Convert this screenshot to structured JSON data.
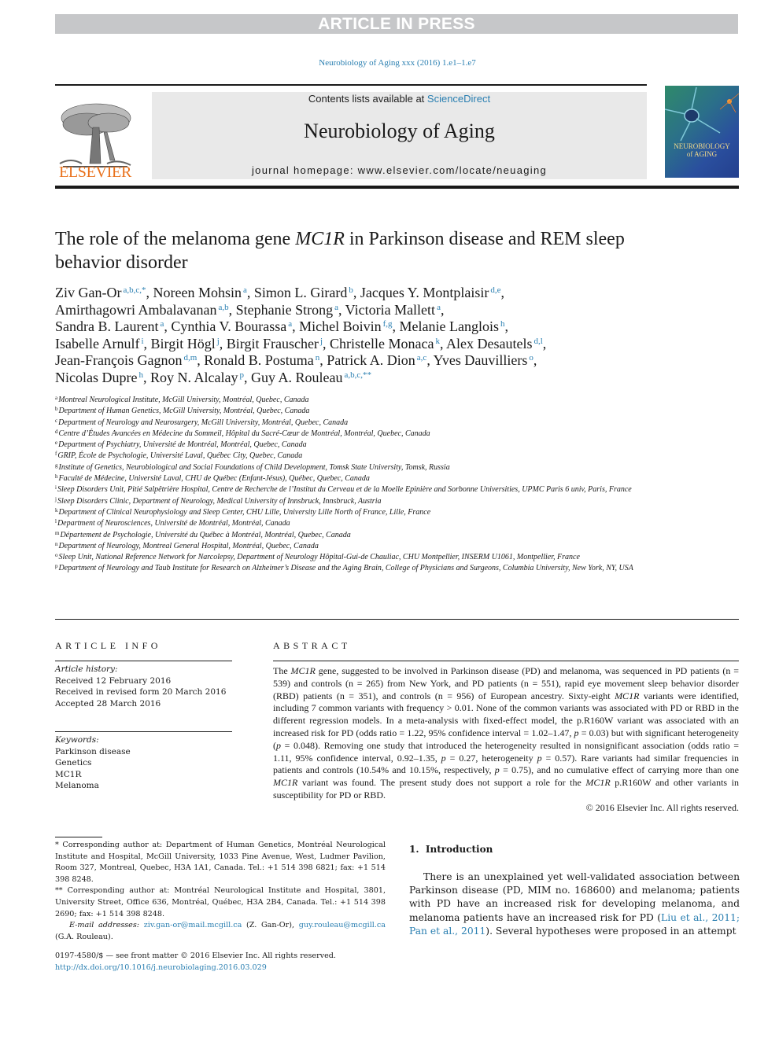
{
  "banner": {
    "text": "ARTICLE IN PRESS"
  },
  "citation": "Neurobiology of Aging xxx (2016) 1.e1–1.e7",
  "masthead": {
    "contents_prefix": "Contents lists available at ",
    "contents_link": "ScienceDirect",
    "journal_name": "Neurobiology of Aging",
    "homepage": "journal homepage: www.elsevier.com/locate/neuaging",
    "publisher_logo_text": "ELSEVIER",
    "cover_title_line1": "NEUROBIOLOGY",
    "cover_title_line2": "of AGING"
  },
  "colors": {
    "link": "#2a7fb1",
    "elsevier_orange": "#e9711c",
    "banner_gray": "#c6c7c9",
    "masthead_gray": "#e9e9e9"
  },
  "article": {
    "title_pre": "The role of the melanoma gene ",
    "title_gene": "MC1R",
    "title_post": " in Parkinson disease and REM sleep behavior disorder",
    "authors": [
      {
        "name": "Ziv Gan-Or",
        "aff": "a,b,c,*"
      },
      {
        "name": "Noreen Mohsin",
        "aff": "a"
      },
      {
        "name": "Simon L. Girard",
        "aff": "b"
      },
      {
        "name": "Jacques Y. Montplaisir",
        "aff": "d,e"
      },
      {
        "name": "Amirthagowri Ambalavanan",
        "aff": "a,b"
      },
      {
        "name": "Stephanie Strong",
        "aff": "a"
      },
      {
        "name": "Victoria Mallett",
        "aff": "a"
      },
      {
        "name": "Sandra B. Laurent",
        "aff": "a"
      },
      {
        "name": "Cynthia V. Bourassa",
        "aff": "a"
      },
      {
        "name": "Michel Boivin",
        "aff": "f,g"
      },
      {
        "name": "Melanie Langlois",
        "aff": "h"
      },
      {
        "name": "Isabelle Arnulf",
        "aff": "i"
      },
      {
        "name": "Birgit Högl",
        "aff": "j"
      },
      {
        "name": "Birgit Frauscher",
        "aff": "j"
      },
      {
        "name": "Christelle Monaca",
        "aff": "k"
      },
      {
        "name": "Alex Desautels",
        "aff": "d,l"
      },
      {
        "name": "Jean-François Gagnon",
        "aff": "d,m"
      },
      {
        "name": "Ronald B. Postuma",
        "aff": "n"
      },
      {
        "name": "Patrick A. Dion",
        "aff": "a,c"
      },
      {
        "name": "Yves Dauvilliers",
        "aff": "o"
      },
      {
        "name": "Nicolas Dupre",
        "aff": "h"
      },
      {
        "name": "Roy N. Alcalay",
        "aff": "p"
      },
      {
        "name": "Guy A. Rouleau",
        "aff": "a,b,c,**"
      }
    ],
    "affiliations": [
      {
        "key": "a",
        "text": "Montreal Neurological Institute, McGill University, Montréal, Quebec, Canada"
      },
      {
        "key": "b",
        "text": "Department of Human Genetics, McGill University, Montréal, Quebec, Canada"
      },
      {
        "key": "c",
        "text": "Department of Neurology and Neurosurgery, McGill University, Montréal, Quebec, Canada"
      },
      {
        "key": "d",
        "text": "Centre d’Études Avancées en Médecine du Sommeil, Hôpital du Sacré-Cœur de Montréal, Montréal, Quebec, Canada"
      },
      {
        "key": "e",
        "text": "Department of Psychiatry, Université de Montréal, Montréal, Quebec, Canada"
      },
      {
        "key": "f",
        "text": "GRIP, École de Psychologie, Université Laval, Québec City, Quebec, Canada"
      },
      {
        "key": "g",
        "text": "Institute of Genetics, Neurobiological and Social Foundations of Child Development, Tomsk State University, Tomsk, Russia"
      },
      {
        "key": "h",
        "text": "Faculté de Médecine, Université Laval, CHU de Québec (Enfant-Jésus), Québec, Quebec, Canada"
      },
      {
        "key": "i",
        "text": "Sleep Disorders Unit, Pitié Salpêtrière Hospital, Centre de Recherche de l’Institut du Cerveau et de la Moelle Epinière and Sorbonne Universities, UPMC Paris 6 univ, Paris, France"
      },
      {
        "key": "j",
        "text": "Sleep Disorders Clinic, Department of Neurology, Medical University of Innsbruck, Innsbruck, Austria"
      },
      {
        "key": "k",
        "text": "Department of Clinical Neurophysiology and Sleep Center, CHU Lille, University Lille North of France, Lille, France"
      },
      {
        "key": "l",
        "text": "Department of Neurosciences, Université de Montréal, Montréal, Canada"
      },
      {
        "key": "m",
        "text": "Département de Psychologie, Université du Québec à Montréal, Montréal, Quebec, Canada"
      },
      {
        "key": "n",
        "text": "Department of Neurology, Montreal General Hospital, Montréal, Quebec, Canada"
      },
      {
        "key": "o",
        "text": "Sleep Unit, National Reference Network for Narcolepsy, Department of Neurology Hôpital-Gui-de Chauliac, CHU Montpellier, INSERM U1061, Montpellier, France"
      },
      {
        "key": "p",
        "text": "Department of Neurology and Taub Institute for Research on Alzheimer’s Disease and the Aging Brain, College of Physicians and Surgeons, Columbia University, New York, NY, USA"
      }
    ]
  },
  "article_info": {
    "heading": "ARTICLE INFO",
    "history_label": "Article history:",
    "history": [
      "Received 12 February 2016",
      "Received in revised form 20 March 2016",
      "Accepted 28 March 2016"
    ],
    "keywords_label": "Keywords:",
    "keywords": [
      "Parkinson disease",
      "Genetics",
      "MC1R",
      "Melanoma"
    ]
  },
  "abstract": {
    "heading": "ABSTRACT",
    "segments": [
      {
        "t": "The "
      },
      {
        "t": "MC1R",
        "i": true
      },
      {
        "t": " gene, suggested to be involved in Parkinson disease (PD) and melanoma, was sequenced in PD patients (n = 539) and controls (n = 265) from New York, and PD patients (n = 551), rapid eye movement sleep behavior disorder (RBD) patients (n = 351), and controls (n = 956) of European ancestry. Sixty-eight "
      },
      {
        "t": "MC1R",
        "i": true
      },
      {
        "t": " variants were identified, including 7 common variants with frequency > 0.01. None of the common variants was associated with PD or RBD in the different regression models. In a meta-analysis with fixed-effect model, the p.R160W variant was associated with an increased risk for PD (odds ratio = 1.22, 95% confidence interval = 1.02–1.47, "
      },
      {
        "t": "p",
        "i": true
      },
      {
        "t": " = 0.03) but with significant heterogeneity ("
      },
      {
        "t": "p",
        "i": true
      },
      {
        "t": " = 0.048). Removing one study that introduced the heterogeneity resulted in nonsignificant association (odds ratio = 1.11, 95% confidence interval, 0.92–1.35, "
      },
      {
        "t": "p",
        "i": true
      },
      {
        "t": " = 0.27, heterogeneity "
      },
      {
        "t": "p",
        "i": true
      },
      {
        "t": " = 0.57). Rare variants had similar frequencies in patients and controls (10.54% and 10.15%, respectively, "
      },
      {
        "t": "p",
        "i": true
      },
      {
        "t": " = 0.75), and no cumulative effect of carrying more than one "
      },
      {
        "t": "MC1R",
        "i": true
      },
      {
        "t": " variant was found. The present study does not support a role for the "
      },
      {
        "t": "MC1R",
        "i": true
      },
      {
        "t": " p.R160W and other variants in susceptibility for PD or RBD."
      }
    ],
    "copyright": "© 2016 Elsevier Inc. All rights reserved."
  },
  "footnotes": {
    "corresponding1": " * Corresponding author at: Department of Human Genetics, Montréal Neurological Institute and Hospital, McGill University, 1033 Pine Avenue, West, Ludmer Pavilion, Room 327, Montreal, Quebec, H3A 1A1, Canada. Tel.: +1 514 398 6821; fax: +1 514 398 8248.",
    "corresponding2": " ** Corresponding author at: Montréal Neurological Institute and Hospital, 3801, University Street, Office 636, Montréal, Québec, H3A 2B4, Canada. Tel.: +1 514 398 2690; fax: +1 514 398 8248.",
    "email_label": "E-mail addresses:",
    "email1": "ziv.gan-or@mail.mcgill.ca",
    "email1_owner": " (Z. Gan-Or), ",
    "email2": "guy.rouleau@mcgill.ca",
    "email2_owner": " (G.A. Rouleau)."
  },
  "front_matter": {
    "issn_line": "0197-4580/$ — see front matter © 2016 Elsevier Inc. All rights reserved.",
    "doi": "http://dx.doi.org/10.1016/j.neurobiolaging.2016.03.029"
  },
  "introduction": {
    "heading": "1.  Introduction",
    "text_before": "There is an unexplained yet well-validated association between Parkinson disease (PD, MIM no. 168600) and melanoma; patients with PD have an increased risk for developing melanoma, and melanoma patients have an increased risk for PD (",
    "ref1": "Liu et al., 2011;",
    "ref_sep": " ",
    "ref2": "Pan et al., 2011",
    "text_after": "). Several hypotheses were proposed in an attempt"
  }
}
